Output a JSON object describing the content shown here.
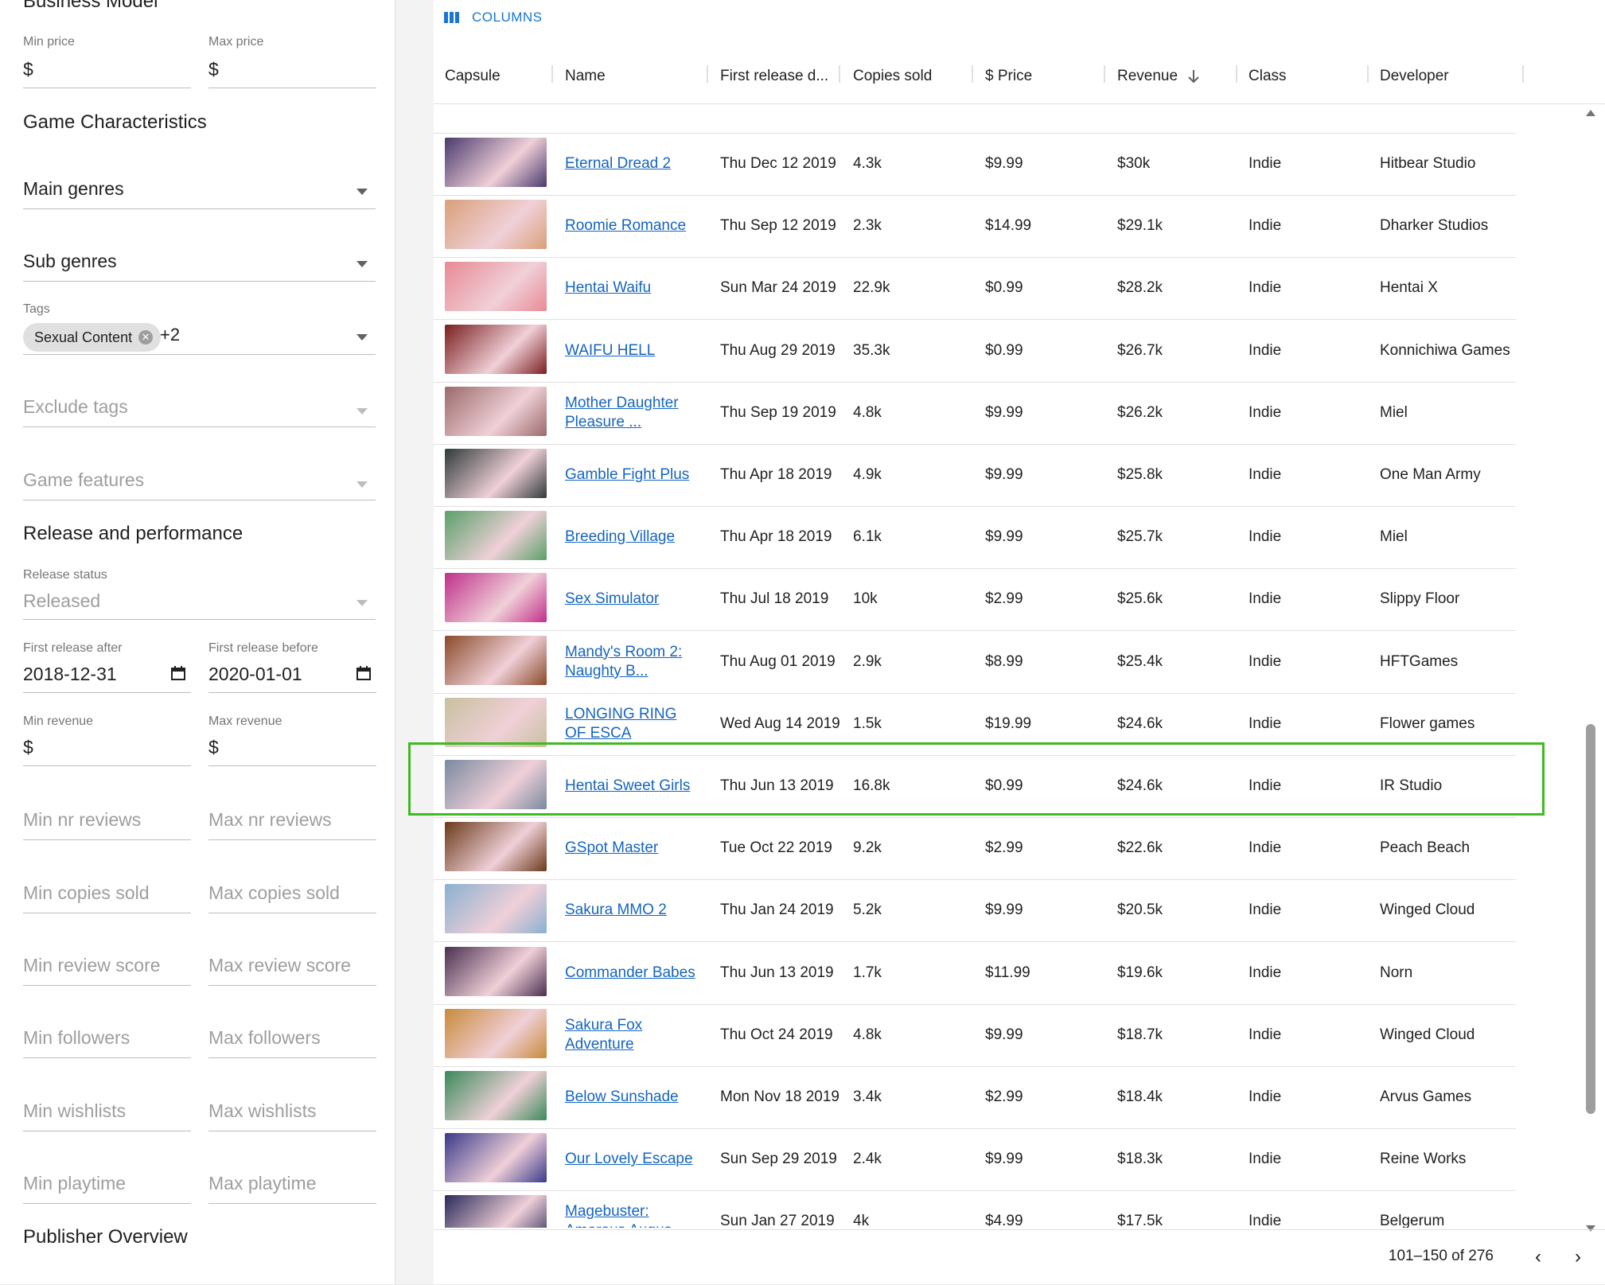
{
  "filters": {
    "top_partial_heading": "Business Model",
    "min_price": {
      "label": "Min price",
      "value": "$"
    },
    "max_price": {
      "label": "Max price",
      "value": "$"
    },
    "game_characteristics": "Game Characteristics",
    "main_genres": "Main genres",
    "sub_genres": "Sub genres",
    "tags": {
      "label": "Tags",
      "chip": "Sexual Content",
      "more": "+2"
    },
    "exclude_tags": "Exclude tags",
    "game_features": "Game features",
    "release_performance": "Release and performance",
    "release_status": {
      "label": "Release status",
      "value": "Released"
    },
    "first_release_after": {
      "label": "First release after",
      "value": "2018-12-31"
    },
    "first_release_before": {
      "label": "First release before",
      "value": "2020-01-01"
    },
    "min_revenue": {
      "label": "Min revenue",
      "value": "$"
    },
    "max_revenue": {
      "label": "Max revenue",
      "value": "$"
    },
    "min_nr_reviews": "Min nr reviews",
    "max_nr_reviews": "Max nr reviews",
    "min_copies_sold": "Min copies sold",
    "max_copies_sold": "Max copies sold",
    "min_review_score": "Min review score",
    "max_review_score": "Max review score",
    "min_followers": "Min followers",
    "max_followers": "Max followers",
    "min_wishlists": "Min wishlists",
    "max_wishlists": "Max wishlists",
    "min_playtime": "Min playtime",
    "max_playtime": "Max playtime",
    "publisher_overview": "Publisher Overview"
  },
  "grid": {
    "columns_button": "COLUMNS",
    "headers": {
      "capsule": "Capsule",
      "name": "Name",
      "first_release": "First release d...",
      "copies": "Copies sold",
      "price": "$ Price",
      "revenue": "Revenue",
      "class": "Class",
      "developer": "Developer"
    },
    "rows": [
      {
        "name": "Eternal Dread 2",
        "date": "Thu Dec 12 2019",
        "copies": "4.3k",
        "price": "$9.99",
        "revenue": "$30k",
        "class": "Indie",
        "developer": "Hitbear Studio",
        "color": "#4a3a6e"
      },
      {
        "name": "Roomie Romance",
        "date": "Thu Sep 12 2019",
        "copies": "2.3k",
        "price": "$14.99",
        "revenue": "$29.1k",
        "class": "Indie",
        "developer": "Dharker Studios",
        "color": "#d9a07a"
      },
      {
        "name": "Hentai Waifu",
        "date": "Sun Mar 24 2019",
        "copies": "22.9k",
        "price": "$0.99",
        "revenue": "$28.2k",
        "class": "Indie",
        "developer": "Hentai X",
        "color": "#e88a94"
      },
      {
        "name": "WAIFU HELL",
        "date": "Thu Aug 29 2019",
        "copies": "35.3k",
        "price": "$0.99",
        "revenue": "$26.7k",
        "class": "Indie",
        "developer": "Konnichiwa Games",
        "color": "#7a1f1f"
      },
      {
        "name": "Mother Daughter Pleasure ...",
        "date": "Thu Sep 19 2019",
        "copies": "4.8k",
        "price": "$9.99",
        "revenue": "$26.2k",
        "class": "Indie",
        "developer": "Miel",
        "color": "#9a6a6a"
      },
      {
        "name": "Gamble Fight Plus",
        "date": "Thu Apr 18 2019",
        "copies": "4.9k",
        "price": "$9.99",
        "revenue": "$25.8k",
        "class": "Indie",
        "developer": "One Man Army",
        "color": "#2f3a3a"
      },
      {
        "name": "Breeding Village",
        "date": "Thu Apr 18 2019",
        "copies": "6.1k",
        "price": "$9.99",
        "revenue": "$25.7k",
        "class": "Indie",
        "developer": "Miel",
        "color": "#5aa06a"
      },
      {
        "name": "Sex Simulator",
        "date": "Thu Jul 18 2019",
        "copies": "10k",
        "price": "$2.99",
        "revenue": "$25.6k",
        "class": "Indie",
        "developer": "Slippy Floor",
        "color": "#c0308a"
      },
      {
        "name": "Mandy's Room 2: Naughty B...",
        "date": "Thu Aug 01 2019",
        "copies": "2.9k",
        "price": "$8.99",
        "revenue": "$25.4k",
        "class": "Indie",
        "developer": "HFTGames",
        "color": "#8a4a2a"
      },
      {
        "name": "LONGING RING OF ESCA",
        "date": "Wed Aug 14 2019",
        "copies": "1.5k",
        "price": "$19.99",
        "revenue": "$24.6k",
        "class": "Indie",
        "developer": "Flower games",
        "color": "#c8c0a0"
      },
      {
        "name": "Hentai Sweet Girls",
        "date": "Thu Jun 13 2019",
        "copies": "16.8k",
        "price": "$0.99",
        "revenue": "$24.6k",
        "class": "Indie",
        "developer": "IR Studio",
        "color": "#7a8aa0"
      },
      {
        "name": "GSpot Master",
        "date": "Tue Oct 22 2019",
        "copies": "9.2k",
        "price": "$2.99",
        "revenue": "$22.6k",
        "class": "Indie",
        "developer": "Peach Beach",
        "color": "#6a3a1a"
      },
      {
        "name": "Sakura MMO 2",
        "date": "Thu Jan 24 2019",
        "copies": "5.2k",
        "price": "$9.99",
        "revenue": "$20.5k",
        "class": "Indie",
        "developer": "Winged Cloud",
        "color": "#8ab0d0"
      },
      {
        "name": "Commander Babes",
        "date": "Thu Jun 13 2019",
        "copies": "1.7k",
        "price": "$11.99",
        "revenue": "$19.6k",
        "class": "Indie",
        "developer": "Norn",
        "color": "#4a3050"
      },
      {
        "name": "Sakura Fox Adventure",
        "date": "Thu Oct 24 2019",
        "copies": "4.8k",
        "price": "$9.99",
        "revenue": "$18.7k",
        "class": "Indie",
        "developer": "Winged Cloud",
        "color": "#c88a3a"
      },
      {
        "name": "Below Sunshade",
        "date": "Mon Nov 18 2019",
        "copies": "3.4k",
        "price": "$2.99",
        "revenue": "$18.4k",
        "class": "Indie",
        "developer": "Arvus Games",
        "color": "#3a8a5a"
      },
      {
        "name": "Our Lovely Escape",
        "date": "Sun Sep 29 2019",
        "copies": "2.4k",
        "price": "$9.99",
        "revenue": "$18.3k",
        "class": "Indie",
        "developer": "Reine Works",
        "color": "#3a3a8a"
      },
      {
        "name": "Magebuster: Amorous Augus...",
        "date": "Sun Jan 27 2019",
        "copies": "4k",
        "price": "$4.99",
        "revenue": "$17.5k",
        "class": "Indie",
        "developer": "Belgerum",
        "color": "#2a2a5a"
      }
    ],
    "pagination": "101–150 of 276"
  },
  "colors": {
    "link": "#1565c0",
    "accent": "#1976d2",
    "highlight": "#3dbb1f"
  }
}
